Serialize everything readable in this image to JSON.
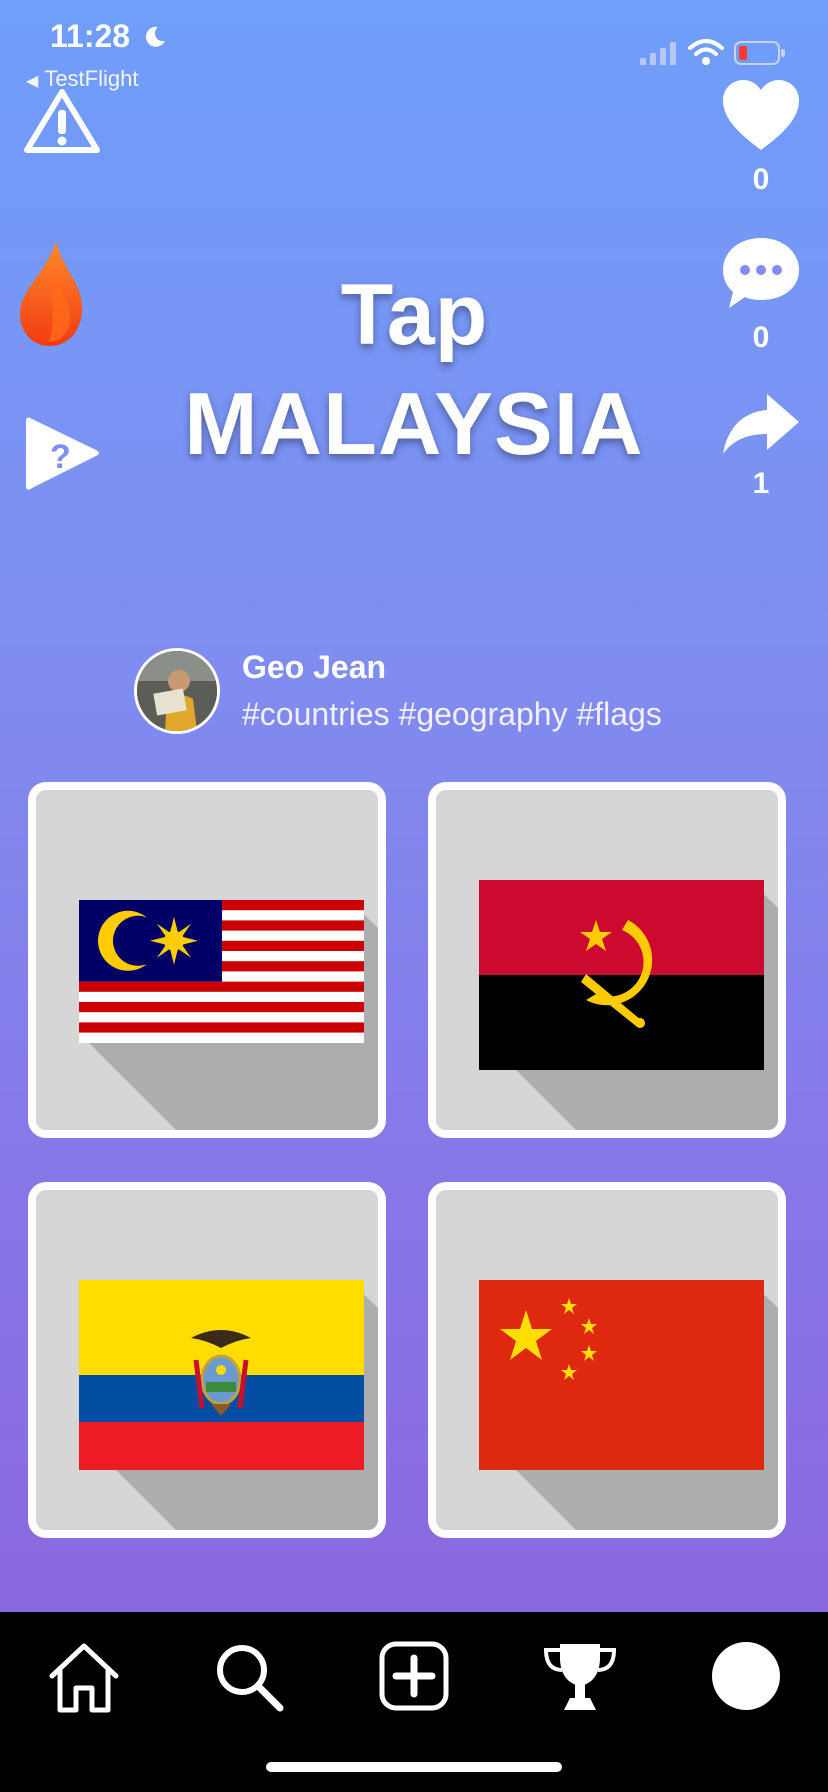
{
  "status_bar": {
    "time": "11:28",
    "back_label": "TestFlight"
  },
  "prompt": {
    "line1": "Tap",
    "line2": "MALAYSIA"
  },
  "actions": {
    "like_count": "0",
    "comment_count": "0",
    "share_count": "1"
  },
  "author": {
    "name": "Geo Jean",
    "tags": "#countries #geography #flags"
  },
  "flags": [
    "Malaysia",
    "Angola",
    "Ecuador",
    "China"
  ],
  "colors": {
    "gradient_top": "#6f9efb",
    "gradient_bottom": "#8c63dc",
    "card_bg": "#d6d6d6",
    "nav_bg": "#000000"
  },
  "nav": {
    "items": [
      "home-icon",
      "search-icon",
      "create-icon",
      "trophy-icon",
      "profile-icon"
    ]
  }
}
